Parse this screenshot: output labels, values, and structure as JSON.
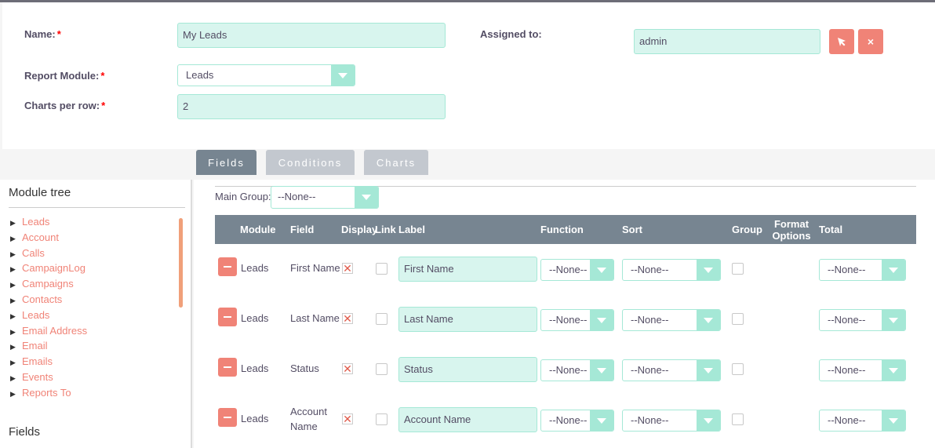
{
  "form": {
    "name_label": "Name:",
    "name_value": "My Leads",
    "assigned_label": "Assigned to:",
    "assigned_value": "admin",
    "module_label": "Report Module:",
    "module_value": "Leads",
    "charts_label": "Charts per row:",
    "charts_value": "2",
    "required_mark": "*",
    "clear_glyph": "×"
  },
  "tabs": [
    {
      "label": "Fields",
      "active": true
    },
    {
      "label": "Conditions",
      "active": false
    },
    {
      "label": "Charts",
      "active": false
    }
  ],
  "sidebar": {
    "module_tree_title": "Module tree",
    "fields_title": "Fields",
    "items": [
      "Leads",
      "Account",
      "Calls",
      "CampaignLog",
      "Campaigns",
      "Contacts",
      "Leads",
      "Email Address",
      "Email",
      "Emails",
      "Events",
      "Reports To"
    ]
  },
  "main": {
    "main_group_label": "Main Group:",
    "main_group_value": "--None--",
    "headers": {
      "module": "Module",
      "field": "Field",
      "display": "Display",
      "link": "Link",
      "label": "Label",
      "function": "Function",
      "sort": "Sort",
      "group": "Group",
      "format_options": "Format Options",
      "total": "Total"
    },
    "rows": [
      {
        "module": "Leads",
        "field": "First Name",
        "label": "First Name",
        "function": "--None--",
        "sort": "--None--",
        "total": "--None--"
      },
      {
        "module": "Leads",
        "field": "Last Name",
        "label": "Last Name",
        "function": "--None--",
        "sort": "--None--",
        "total": "--None--"
      },
      {
        "module": "Leads",
        "field": "Status",
        "label": "Status",
        "function": "--None--",
        "sort": "--None--",
        "total": "--None--"
      },
      {
        "module": "Leads",
        "field": "Account Name",
        "label": "Account Name",
        "function": "--None--",
        "sort": "--None--",
        "total": "--None--"
      }
    ],
    "display_mark": "✕"
  },
  "colors": {
    "accent_teal": "#a5e8d6",
    "input_bg": "#d8f5ee",
    "danger": "#f08377",
    "header_slate": "#778591",
    "link_orange": "#f08377"
  }
}
